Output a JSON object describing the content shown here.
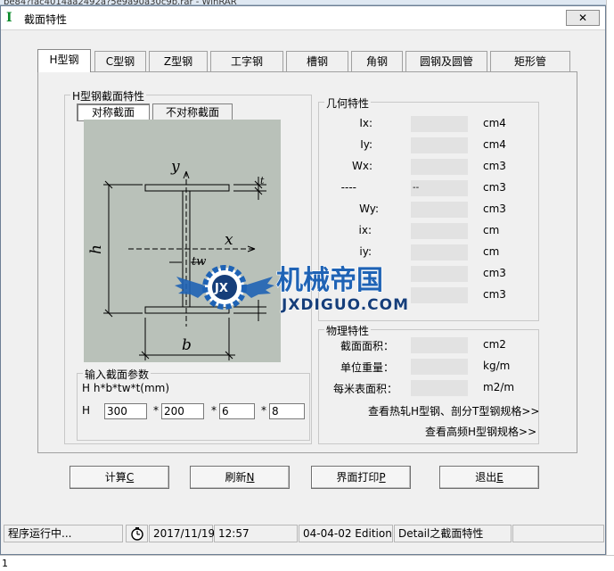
{
  "background": {
    "behind_title": "be84?fac4014aa2492a?5e9a90a30c9b.rar - WinRAR",
    "bottom_left_char": "1"
  },
  "window": {
    "icon_glyph": "I",
    "title": "截面特性",
    "close_glyph": "✕"
  },
  "tabs": [
    {
      "label": "H型钢",
      "active": true
    },
    {
      "label": "C型钢"
    },
    {
      "label": "Z型钢"
    },
    {
      "label": "工字钢"
    },
    {
      "label": "槽钢"
    },
    {
      "label": "角钢"
    },
    {
      "label": "圆钢及圆管"
    },
    {
      "label": "矩形管"
    }
  ],
  "section_group": {
    "legend": "H型钢截面特性",
    "sym_button": "对称截面",
    "asym_button": "不对称截面"
  },
  "drawing": {
    "y_axis": "y",
    "x_axis": "x",
    "h": "h",
    "b": "b",
    "t": "t",
    "tw": "tw",
    "colors": {
      "bg": "#b9c1b9",
      "line": "#000000"
    }
  },
  "input_group": {
    "legend": "输入截面参数",
    "formula": "H   h*b*tw*t(mm)",
    "prefix": "H",
    "values": [
      "300",
      "200",
      "6",
      "8"
    ],
    "separator": "*"
  },
  "geometry_group": {
    "legend": "几何特性",
    "rows": [
      {
        "label": "Ix:",
        "unit": "cm4"
      },
      {
        "label": "Iy:",
        "unit": "cm4"
      },
      {
        "label": "Wx:",
        "unit": "cm3"
      },
      {
        "label": "----",
        "value": "--",
        "unit": "cm3"
      },
      {
        "label": "Wy:",
        "unit": "cm3"
      },
      {
        "label": "ix:",
        "unit": "cm"
      },
      {
        "label": "iy:",
        "unit": "cm"
      },
      {
        "label": "",
        "unit": "cm3"
      },
      {
        "label": "",
        "unit": "cm3"
      }
    ]
  },
  "physical_group": {
    "legend": "物理特性",
    "rows": [
      {
        "label": "截面面积：",
        "unit": "cm2"
      },
      {
        "label": "单位重量：",
        "unit": "kg/m"
      },
      {
        "label": "每米表面积：",
        "unit": "m2/m"
      }
    ],
    "link1": "查看热轧H型钢、剖分T型钢规格>>",
    "link2": "查看高频H型钢规格>>"
  },
  "buttons": {
    "calc": "计算",
    "calc_key": "C",
    "refresh": "刷新",
    "refresh_key": "N",
    "print": "界面打印",
    "print_key": "P",
    "exit": "退出",
    "exit_key": "E"
  },
  "status": {
    "running": "程序运行中...",
    "date": "2017/11/19",
    "time": "12:57",
    "edition": "04-04-02 Edition",
    "detail": "Detail之截面特性"
  },
  "watermark": {
    "brand_cn": "机械帝国",
    "brand_en": "JXDIGUO.COM",
    "logo_text": "JX",
    "colors": {
      "blue": "#1f63b5",
      "navy": "#163e7a"
    }
  }
}
